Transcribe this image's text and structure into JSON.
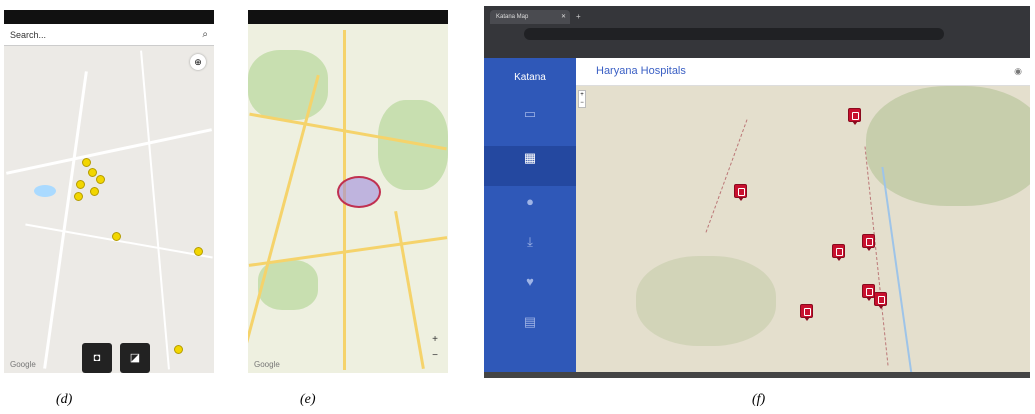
{
  "panel_d": {
    "search_placeholder": "Search...",
    "google_logo": "Google",
    "caption": "(d)"
  },
  "panel_e": {
    "google_logo": "Google",
    "zoom_in": "+",
    "zoom_out": "−",
    "caption": "(e)"
  },
  "panel_f": {
    "tab_title": "Katana Map",
    "brand": "Katana",
    "page_title": "Haryana Hospitals",
    "nav": [
      {
        "icon": "laptop-icon",
        "glyph": "▭",
        "label": "DASHBOARD"
      },
      {
        "icon": "map-icon",
        "glyph": "▦",
        "label": "MAPS"
      },
      {
        "icon": "user-icon",
        "glyph": "●",
        "label": "PROFILE"
      },
      {
        "icon": "download-icon",
        "glyph": "⤓",
        "label": "DOWNLOAD"
      },
      {
        "icon": "heart-icon",
        "glyph": "♥",
        "label": "HEALTH"
      },
      {
        "icon": "building-icon",
        "glyph": "▤",
        "label": "HOSPITALS"
      }
    ],
    "caption": "(f)"
  },
  "colors": {
    "sidebar": "#2f58b8",
    "pin_red": "#c8102e",
    "pin_yellow": "#f2d600"
  }
}
